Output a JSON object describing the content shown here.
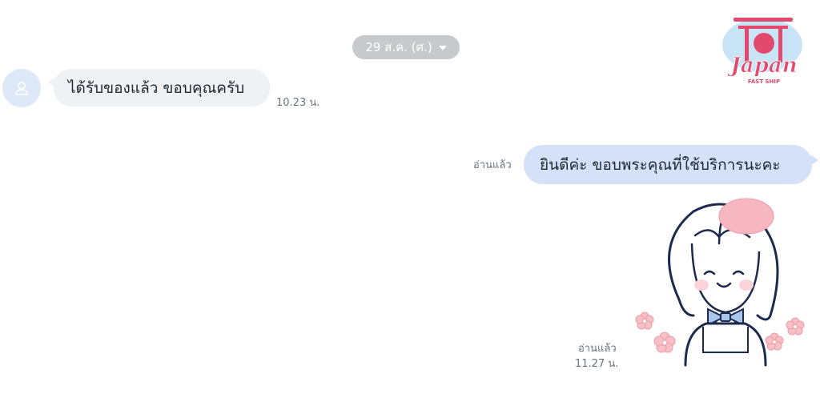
{
  "date_pill": {
    "label": "29 ส.ค. (ศ.)",
    "icon": "chevron-down-icon"
  },
  "messages": [
    {
      "sender": "other",
      "text": "ได้รับของแล้ว ขอบคุณครับ",
      "time": "10.23 น."
    },
    {
      "sender": "me",
      "text": "ยินดีค่ะ ขอบพระคุณที่ใช้บริการนะคะ",
      "status": "อ่านแล้ว"
    },
    {
      "sender": "me",
      "type": "sticker",
      "sticker": "girl-beret-sticker",
      "status": "อ่านแล้ว",
      "time": "11.27 น."
    }
  ],
  "logo": {
    "title": "Japan",
    "subtitle": "FAST SHIP"
  },
  "colors": {
    "incoming_bubble": "#eff1f4",
    "outgoing_bubble": "#d4e1f8",
    "date_pill": "#c7c9cc",
    "avatar_bg": "#dde8f8",
    "logo_pink": "#e24a6d"
  }
}
